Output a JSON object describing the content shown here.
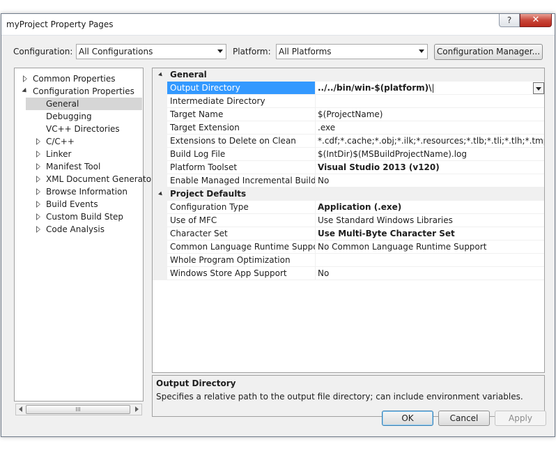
{
  "window": {
    "title": "myProject Property Pages",
    "help_label": "?",
    "close_label": "✕"
  },
  "config_bar": {
    "configuration_label": "Configuration:",
    "configuration_value": "All Configurations",
    "platform_label": "Platform:",
    "platform_value": "All Platforms",
    "config_manager_label": "Configuration Manager..."
  },
  "tree": {
    "items": [
      {
        "label": "Common Properties",
        "state": "collapsed",
        "level": 0
      },
      {
        "label": "Configuration Properties",
        "state": "expanded",
        "level": 0
      },
      {
        "label": "General",
        "state": "leaf",
        "level": 1,
        "selected": true
      },
      {
        "label": "Debugging",
        "state": "leaf",
        "level": 1
      },
      {
        "label": "VC++ Directories",
        "state": "leaf",
        "level": 1
      },
      {
        "label": "C/C++",
        "state": "collapsed",
        "level": 1
      },
      {
        "label": "Linker",
        "state": "collapsed",
        "level": 1
      },
      {
        "label": "Manifest Tool",
        "state": "collapsed",
        "level": 1
      },
      {
        "label": "XML Document Generator",
        "state": "collapsed",
        "level": 1
      },
      {
        "label": "Browse Information",
        "state": "collapsed",
        "level": 1
      },
      {
        "label": "Build Events",
        "state": "collapsed",
        "level": 1
      },
      {
        "label": "Custom Build Step",
        "state": "collapsed",
        "level": 1
      },
      {
        "label": "Code Analysis",
        "state": "collapsed",
        "level": 1
      }
    ],
    "scroll_thumb_label": "III"
  },
  "grid": {
    "sections": [
      {
        "title": "General",
        "rows": [
          {
            "name": "Output Directory",
            "value": "../../bin/win-$(platform)\\",
            "bold": true,
            "selected": true
          },
          {
            "name": "Intermediate Directory",
            "value": "",
            "bold": false
          },
          {
            "name": "Target Name",
            "value": "$(ProjectName)",
            "bold": false
          },
          {
            "name": "Target Extension",
            "value": ".exe",
            "bold": false
          },
          {
            "name": "Extensions to Delete on Clean",
            "value": "*.cdf;*.cache;*.obj;*.ilk;*.resources;*.tlb;*.tli;*.tlh;*.tmp;*.rsp;*.pgc",
            "bold": false
          },
          {
            "name": "Build Log File",
            "value": "$(IntDir)$(MSBuildProjectName).log",
            "bold": false
          },
          {
            "name": "Platform Toolset",
            "value": "Visual Studio 2013 (v120)",
            "bold": true
          },
          {
            "name": "Enable Managed Incremental Build",
            "value": "No",
            "bold": false
          }
        ]
      },
      {
        "title": "Project Defaults",
        "rows": [
          {
            "name": "Configuration Type",
            "value": "Application (.exe)",
            "bold": true
          },
          {
            "name": "Use of MFC",
            "value": "Use Standard Windows Libraries",
            "bold": false
          },
          {
            "name": "Character Set",
            "value": "Use Multi-Byte Character Set",
            "bold": true
          },
          {
            "name": "Common Language Runtime Support",
            "value": "No Common Language Runtime Support",
            "bold": false
          },
          {
            "name": "Whole Program Optimization",
            "value": "",
            "bold": false
          },
          {
            "name": "Windows Store App Support",
            "value": "No",
            "bold": false
          }
        ]
      }
    ]
  },
  "description": {
    "title": "Output Directory",
    "text": "Specifies a relative path to the output file directory; can include environment variables."
  },
  "buttons": {
    "ok": "OK",
    "cancel": "Cancel",
    "apply": "Apply"
  },
  "colors": {
    "selection": "#3399ff",
    "dialog_bg": "#f0f0f0",
    "default_button_border": "#3c7fb1"
  }
}
